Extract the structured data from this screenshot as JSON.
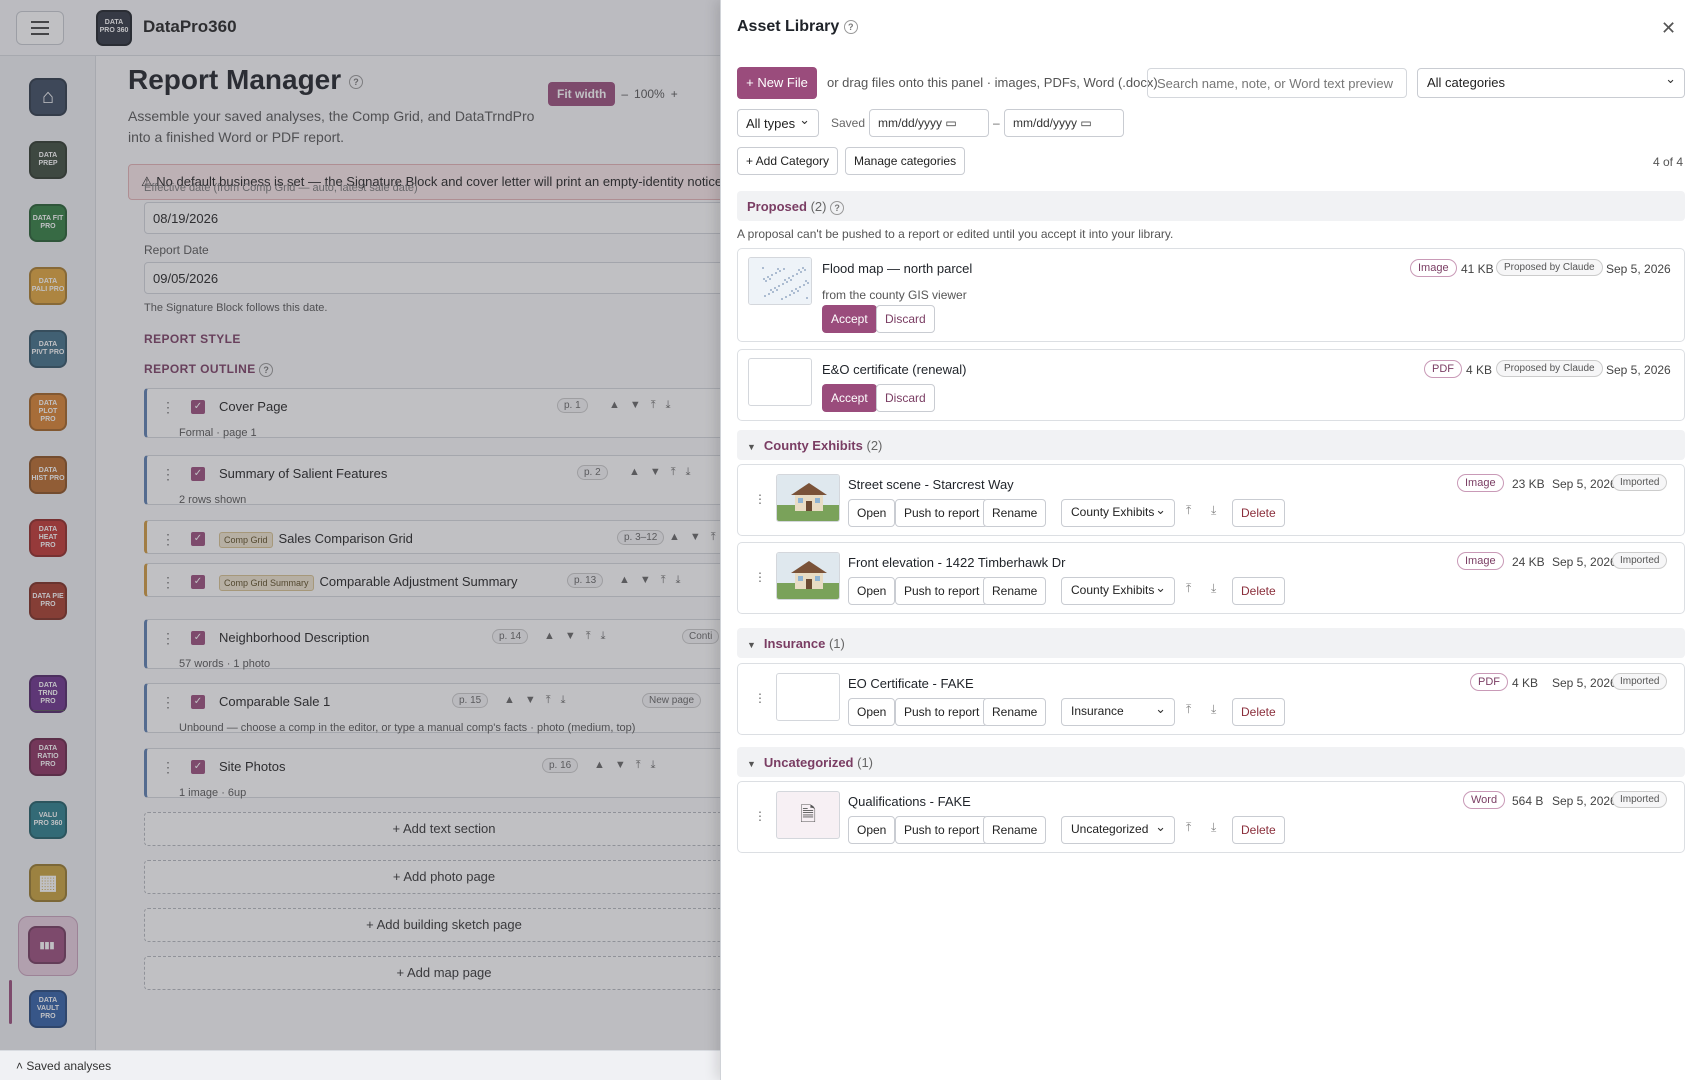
{
  "app": {
    "name": "DataPro360",
    "logo_text": "DATA PRO 360"
  },
  "rail": {
    "apps": [
      {
        "name": "Home",
        "color": "#3a4a5e",
        "text": ""
      },
      {
        "name": "DataPrepPro",
        "color": "#3b4a3a",
        "text": "DATA PREP"
      },
      {
        "name": "DataFitPro",
        "color": "#2f7d3f",
        "text": "DATA FIT PRO"
      },
      {
        "name": "DataPaliPro",
        "color": "#e2a63a",
        "text": "DATA PALI PRO"
      },
      {
        "name": "DataPivtPro",
        "color": "#3f6e86",
        "text": "DATA PIVT PRO"
      },
      {
        "name": "DataPlotPro",
        "color": "#d9822e",
        "text": "DATA PLOT PRO"
      },
      {
        "name": "DataHistPro",
        "color": "#b86a2a",
        "text": "DATA HIST PRO"
      },
      {
        "name": "DataHeatPro",
        "color": "#c0352f",
        "text": "DATA HEAT PRO"
      },
      {
        "name": "DataPiePro",
        "color": "#a63a2a",
        "text": "DATA PIE PRO"
      },
      {
        "name": "DataTrndPro",
        "color": "#6b2f8a",
        "text": "DATA TRND PRO"
      },
      {
        "name": "DataRatioPro",
        "color": "#8a2f5e",
        "text": "DATA RATIO PRO"
      },
      {
        "name": "ValuPro360",
        "color": "#2a7d8a",
        "text": "VALU PRO 360"
      },
      {
        "name": "Grid",
        "color": "#c9a23a",
        "text": ""
      },
      {
        "name": "ReportManager",
        "color": "#9a4c7c",
        "text": ""
      },
      {
        "name": "DataVaultPro",
        "color": "#2f5fa6",
        "text": "DATA VAULT PRO"
      }
    ]
  },
  "footer": {
    "label": "Saved analyses"
  },
  "main": {
    "title": "Report Manager",
    "subtitle": "Assemble your saved analyses, the Comp Grid, and DataTrndPro into a finished Word or PDF report.",
    "fit_width": "Fit width",
    "zoom_minus": "–",
    "zoom": "100%",
    "zoom_plus": "+",
    "warning": "⚠ No default business is set — the Signature Block and cover letter will print an empty-identity notice, an",
    "effective_label": "Effective date (from Comp Grid — auto, latest sale date)",
    "effective_value": "08/19/2026",
    "report_date_label": "Report Date",
    "report_date_value": "09/05/2026",
    "sig_note": "The Signature Block follows this date.",
    "report_style": "REPORT STYLE",
    "report_outline": "REPORT OUTLINE",
    "outline": [
      {
        "title": "Cover Page",
        "tag": "",
        "sub": "Formal · page 1",
        "page": "p. 1"
      },
      {
        "title": "Summary of Salient Features",
        "tag": "",
        "sub": "2 rows shown",
        "page": "p. 2"
      },
      {
        "title": "Sales Comparison Grid",
        "tag": "Comp Grid",
        "sub": "",
        "page": "p. 3–12"
      },
      {
        "title": "Comparable Adjustment Summary",
        "tag": "Comp Grid Summary",
        "sub": "",
        "page": "p. 13"
      },
      {
        "title": "Neighborhood Description",
        "tag": "",
        "sub": "57 words · 1 photo",
        "page": "p. 14",
        "extra": "Conti"
      },
      {
        "title": "Comparable Sale 1",
        "tag": "",
        "sub": "Unbound — choose a comp in the editor, or type a manual comp's facts · photo (medium, top)",
        "page": "p. 15",
        "extra": "New page"
      },
      {
        "title": "Site Photos",
        "tag": "",
        "sub": "1 image · 6up",
        "page": "p. 16"
      }
    ],
    "add_buttons": [
      "+ Add text section",
      "+ Add photo page",
      "+ Add building sketch page",
      "+ Add map page"
    ]
  },
  "panel": {
    "title": "Asset Library",
    "new_file": "+ New File",
    "drag_hint": "or drag files onto this panel · images, PDFs, Word (.docx)",
    "search_placeholder": "Search name, note, or Word text preview",
    "category_filter": "All categories",
    "type_filter": "All types",
    "saved_label": "Saved",
    "date_placeholder": "mm/dd/yyyy",
    "date_sep": "–",
    "add_category": "+ Add Category",
    "manage_categories": "Manage categories",
    "count": "4 of 4",
    "proposed": {
      "label": "Proposed",
      "count": "(2)",
      "note": "A proposal can't be pushed to a report or edited until you accept it into your library.",
      "items": [
        {
          "title": "Flood map — north parcel",
          "sub": "from the county GIS viewer",
          "type": "Image",
          "size": "41 KB",
          "by": "Proposed by Claude",
          "date": "Sep 5, 2026"
        },
        {
          "title": "E&O certificate (renewal)",
          "sub": "",
          "type": "PDF",
          "size": "4 KB",
          "by": "Proposed by Claude",
          "date": "Sep 5, 2026"
        }
      ],
      "accept": "Accept",
      "discard": "Discard"
    },
    "groups": [
      {
        "label": "County Exhibits",
        "count": "(2)",
        "items": [
          {
            "title": "Street scene - Starcrest Way",
            "type": "Image",
            "size": "23 KB",
            "date": "Sep 5, 2026",
            "status": "Imported",
            "category": "County Exhibits",
            "thumb": "house"
          },
          {
            "title": "Front elevation - 1422 Timberhawk Dr",
            "type": "Image",
            "size": "24 KB",
            "date": "Sep 5, 2026",
            "status": "Imported",
            "category": "County Exhibits",
            "thumb": "house"
          }
        ]
      },
      {
        "label": "Insurance",
        "count": "(1)",
        "items": [
          {
            "title": "EO Certificate - FAKE",
            "type": "PDF",
            "size": "4 KB",
            "date": "Sep 5, 2026",
            "status": "Imported",
            "category": "Insurance",
            "thumb": "blank"
          }
        ]
      },
      {
        "label": "Uncategorized",
        "count": "(1)",
        "items": [
          {
            "title": "Qualifications - FAKE",
            "type": "Word",
            "size": "564 B",
            "date": "Sep 5, 2026",
            "status": "Imported",
            "category": "Uncategorized",
            "thumb": "doc"
          }
        ]
      }
    ],
    "actions": {
      "open": "Open",
      "push": "Push to report",
      "rename": "Rename",
      "delete": "Delete"
    }
  }
}
